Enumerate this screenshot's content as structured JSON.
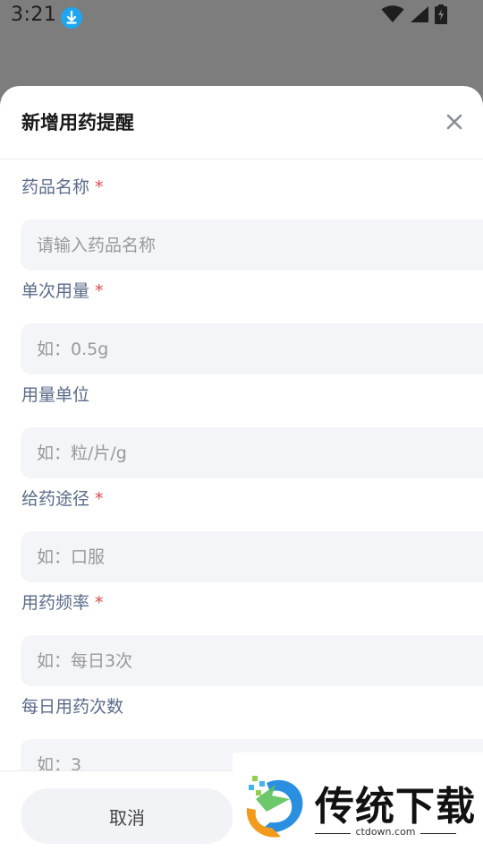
{
  "status_bar": {
    "time": "3:21"
  },
  "dialog": {
    "title": "新增用药提醒",
    "close_icon": "close-icon"
  },
  "form": {
    "fields": [
      {
        "label": "药品名称",
        "required": true,
        "placeholder": "请输入药品名称",
        "value": ""
      },
      {
        "label": "单次用量",
        "required": true,
        "placeholder": "如：0.5g",
        "value": ""
      },
      {
        "label": "用量单位",
        "required": false,
        "placeholder": "如：粒/片/g",
        "value": ""
      },
      {
        "label": "给药途径",
        "required": true,
        "placeholder": "如：口服",
        "value": ""
      },
      {
        "label": "用药频率",
        "required": true,
        "placeholder": "如：每日3次",
        "value": ""
      },
      {
        "label": "每日用药次数",
        "required": false,
        "placeholder": "如：3",
        "value": ""
      }
    ],
    "required_mark": "*"
  },
  "footer": {
    "cancel_label": "取消"
  },
  "watermark": {
    "brand": "传统下载",
    "domain": "ctdown.com"
  },
  "colors": {
    "label": "#5a6b8a",
    "required": "#e04848",
    "input_bg": "#f3f5f8",
    "overlay": "#7d7d7d",
    "download_badge": "#1ea6f0"
  }
}
